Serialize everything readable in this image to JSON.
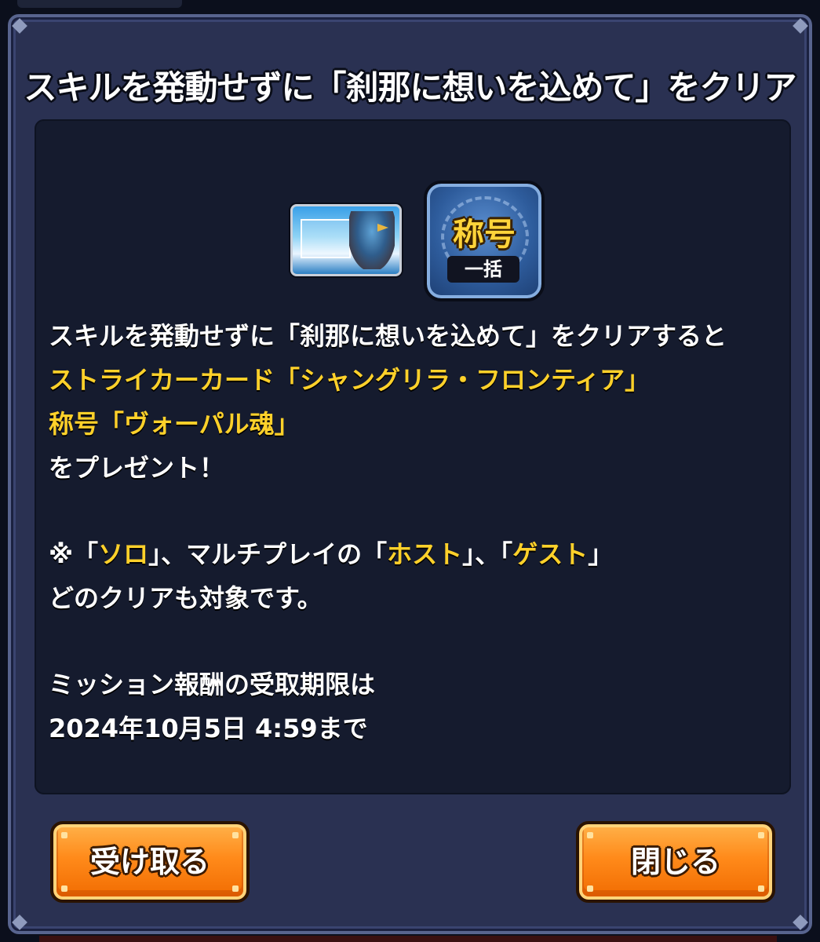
{
  "dialog": {
    "title": "スキルを発動せずに「刹那に想いを込めて」をクリア",
    "rewards": {
      "card_icon": "striker-card-icon",
      "title_badge_main": "称号",
      "title_badge_sub": "一括"
    },
    "description": {
      "line1": "スキルを発動せずに「刹那に想いを込めて」をクリアすると",
      "reward_card": "ストライカーカード「シャングリラ・フロンティア」",
      "reward_title": "称号「ヴォーパル魂」",
      "line_present": "をプレゼント！",
      "note_prefix": "※「",
      "note_solo": "ソロ",
      "note_mid1": "」、マルチプレイの「",
      "note_host": "ホスト",
      "note_mid2": "」、「",
      "note_guest": "ゲスト",
      "note_suffix": "」",
      "note_line2": "どのクリアも対象です。",
      "deadline_label": "ミッション報酬の受取期限は",
      "deadline_value": "2024年10月5日 4:59まで"
    },
    "buttons": {
      "receive": "受け取る",
      "close": "閉じる"
    }
  },
  "colors": {
    "dialog_bg": "#2a3152",
    "panel_bg": "#151b2e",
    "highlight": "#ffd12a",
    "button_orange": "#ff8a1a"
  }
}
